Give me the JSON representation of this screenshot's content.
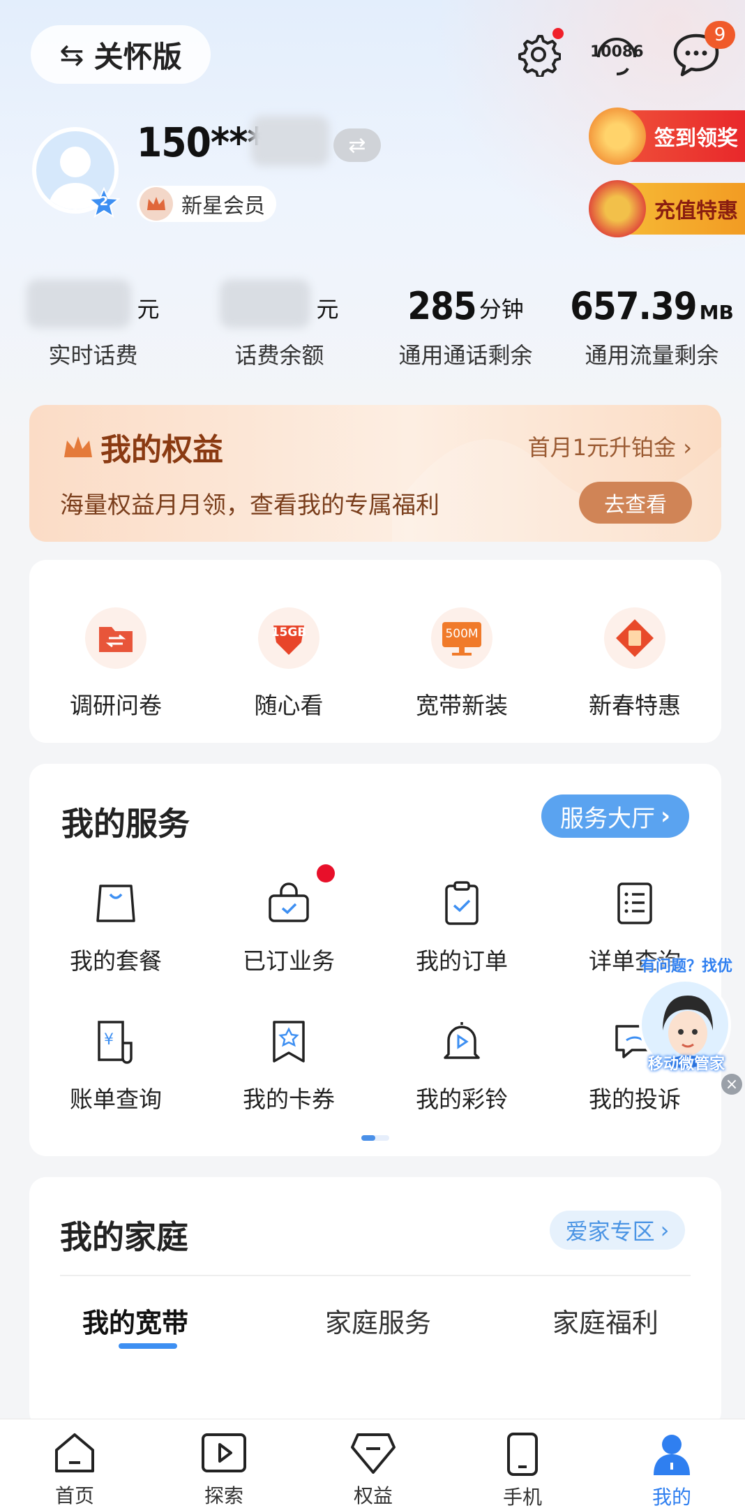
{
  "header": {
    "care_mode_label": "关怀版",
    "hotline_number": "10086",
    "messages_count": "9"
  },
  "profile": {
    "phone": "150****",
    "level": "2",
    "member_label": "新星会员",
    "promo_signin": "签到领奖",
    "promo_recharge": "充值特惠"
  },
  "balances": [
    {
      "value": "",
      "unit": "元",
      "label": "实时话费"
    },
    {
      "value": "",
      "unit": "元",
      "label": "话费余额"
    },
    {
      "value": "285",
      "unit": "分钟",
      "label": "通用通话剩余"
    },
    {
      "value": "657.39",
      "unit": "MB",
      "label": "通用流量剩余"
    }
  ],
  "equity": {
    "title": "我的权益",
    "link": "首月1元升铂金",
    "subtitle": "海量权益月月领，查看我的专属福利",
    "button": "去查看"
  },
  "shortcuts": [
    {
      "label": "调研问卷",
      "icon": "survey-folder-icon"
    },
    {
      "label": "随心看",
      "icon": "data-15gb-icon",
      "badge_text": "15GB"
    },
    {
      "label": "宽带新装",
      "icon": "broadband-500m-icon",
      "badge_text": "500M"
    },
    {
      "label": "新春特惠",
      "icon": "spring-offer-icon"
    }
  ],
  "services": {
    "title": "我的服务",
    "hall_button": "服务大厅",
    "items": [
      {
        "label": "我的套餐",
        "icon": "bag-icon"
      },
      {
        "label": "已订业务",
        "icon": "subscribed-bag-icon"
      },
      {
        "label": "我的订单",
        "icon": "clipboard-check-icon"
      },
      {
        "label": "详单查询",
        "icon": "list-doc-icon"
      },
      {
        "label": "账单查询",
        "icon": "bill-yuan-icon"
      },
      {
        "label": "我的卡券",
        "icon": "coupon-star-icon"
      },
      {
        "label": "我的彩铃",
        "icon": "bell-play-icon"
      },
      {
        "label": "我的投诉",
        "icon": "complaint-icon"
      }
    ]
  },
  "assistant": {
    "bubble_text": "有问题？找优惠？",
    "name": "移动微管家"
  },
  "family": {
    "title": "我的家庭",
    "zone_button": "爱家专区",
    "tabs": [
      "我的宽带",
      "家庭服务",
      "家庭福利"
    ]
  },
  "bottom_nav": [
    {
      "label": "首页",
      "icon": "home-icon"
    },
    {
      "label": "探索",
      "icon": "explore-play-icon"
    },
    {
      "label": "权益",
      "icon": "gem-icon"
    },
    {
      "label": "手机",
      "icon": "phone-icon"
    },
    {
      "label": "我的",
      "icon": "person-icon"
    }
  ],
  "colors": {
    "accent": "#2f7ff0",
    "hall_button": "#5aa3f0",
    "equity_brown": "#8a3a12",
    "equity_button": "#d08456"
  }
}
